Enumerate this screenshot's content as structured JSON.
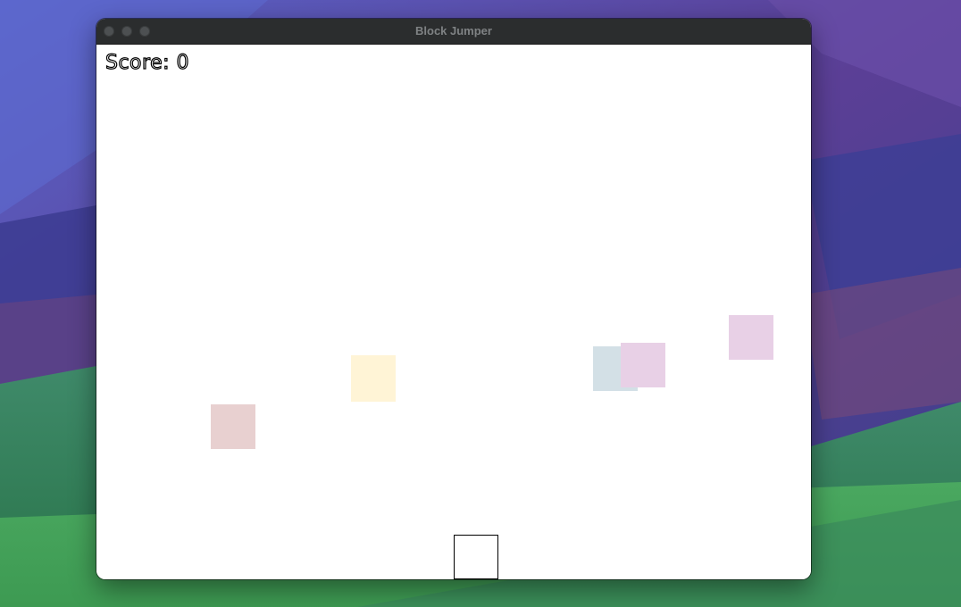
{
  "window": {
    "title": "Block Jumper"
  },
  "game": {
    "score_text": "Score: 0",
    "background_color": "#ffffff",
    "blocks": [
      {
        "name": "block-rose",
        "color": "#e8d0d0"
      },
      {
        "name": "block-cream",
        "color": "#fff4d6"
      },
      {
        "name": "block-blue",
        "color": "#d3e0e6"
      },
      {
        "name": "block-lilac-center",
        "color": "#e8d0e6"
      },
      {
        "name": "block-lilac-right",
        "color": "#e8d0e6"
      }
    ],
    "player": {
      "fill": "#ffffff",
      "border": "#000000"
    }
  }
}
